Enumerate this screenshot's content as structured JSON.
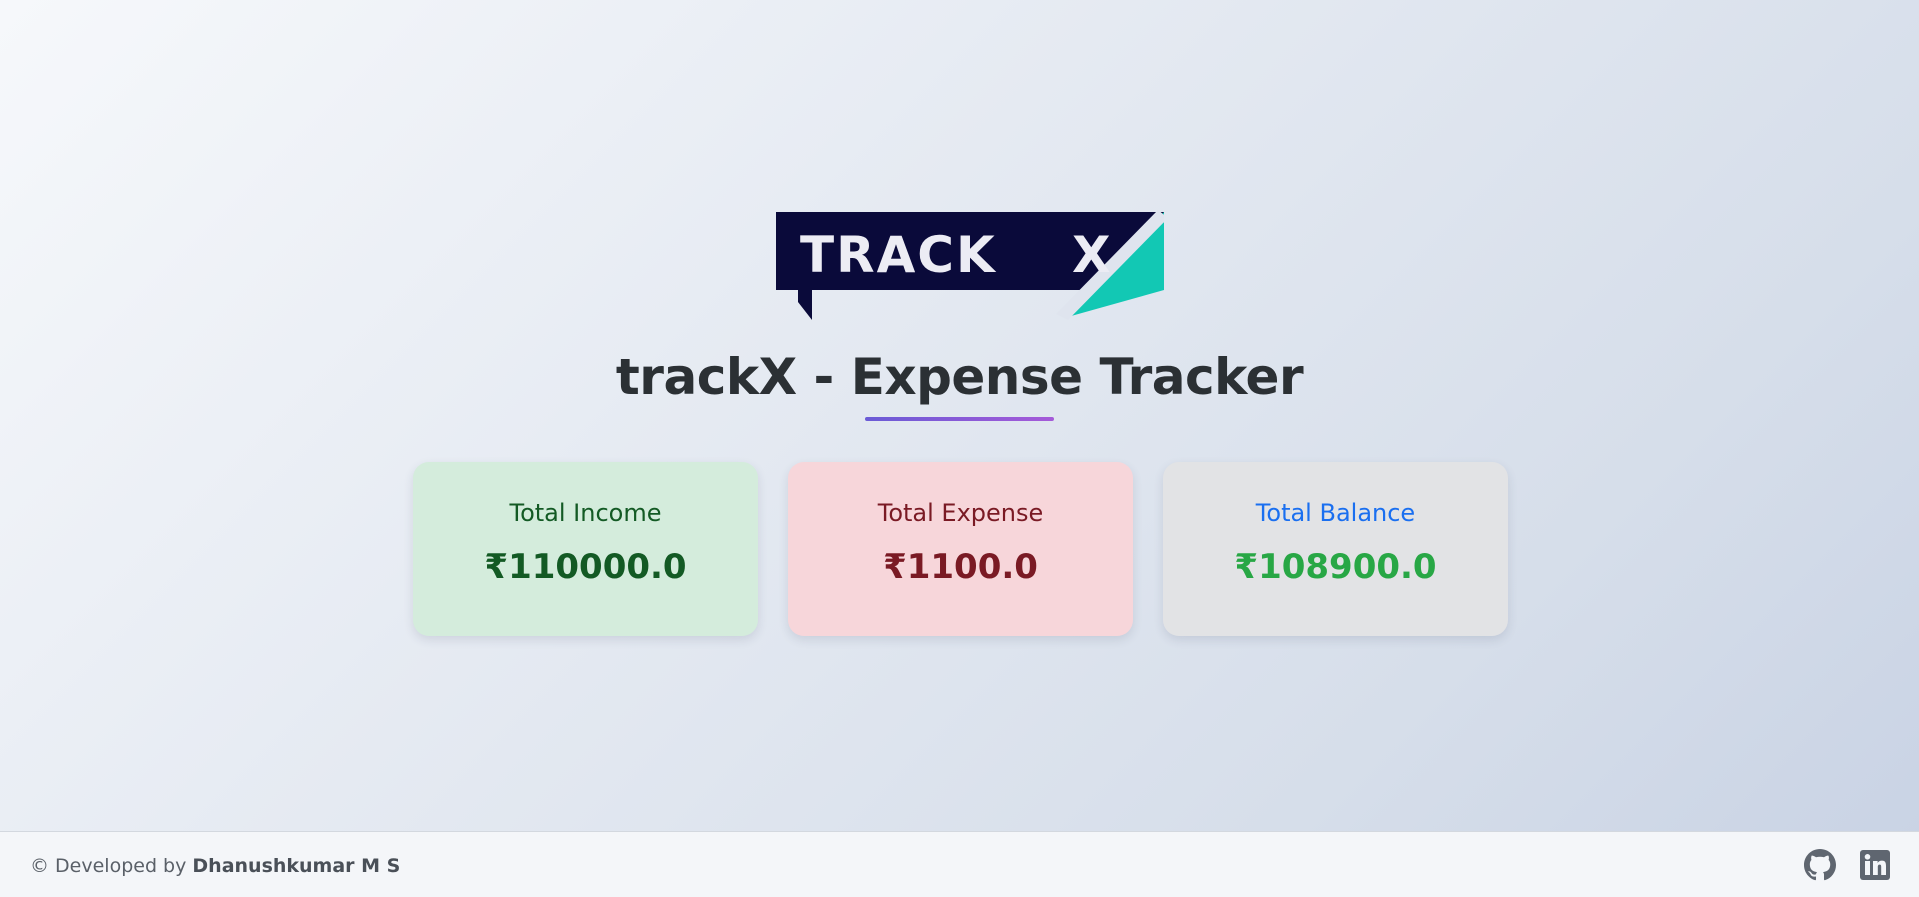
{
  "app": {
    "logo_alt": "TRACK X",
    "title": "trackX - Expense Tracker"
  },
  "cards": {
    "income": {
      "label": "Total Income",
      "value": "₹110000.0"
    },
    "expense": {
      "label": "Total Expense",
      "value": "₹1100.0"
    },
    "balance": {
      "label": "Total Balance",
      "value": "₹108900.0"
    }
  },
  "footer": {
    "prefix": "© Developed by ",
    "author": "Dhanushkumar M S",
    "links": [
      {
        "icon": "github-icon"
      },
      {
        "icon": "linkedin-icon"
      }
    ]
  },
  "colors": {
    "logo_dark": "#0a0a3a",
    "logo_teal": "#12c8b4",
    "income_bg": "#d4ecdc",
    "income_text": "#135a24",
    "expense_bg": "#f7d6da",
    "expense_text": "#7a1a24",
    "balance_bg": "#e2e3e5",
    "balance_label": "#1a6ff0",
    "balance_value": "#28a745"
  }
}
